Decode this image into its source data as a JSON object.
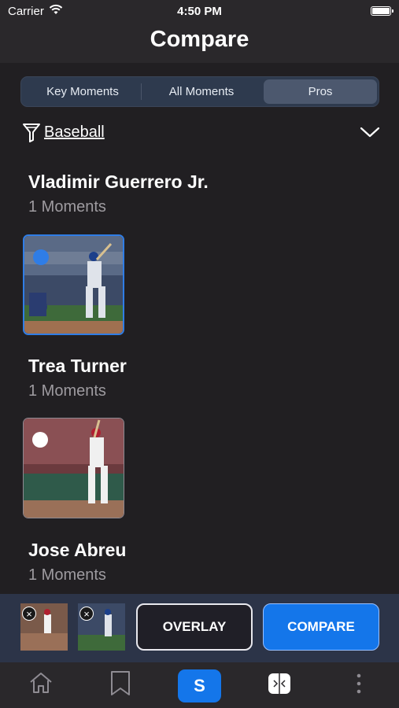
{
  "status": {
    "carrier": "Carrier",
    "time": "4:50 PM"
  },
  "header": {
    "title": "Compare"
  },
  "tabs": [
    {
      "label": "Key Moments",
      "selected": false
    },
    {
      "label": "All Moments",
      "selected": false
    },
    {
      "label": "Pros",
      "selected": true
    }
  ],
  "filter": {
    "label": "Baseball"
  },
  "players": [
    {
      "name": "Vladimir Guerrero Jr.",
      "moments": "1 Moments",
      "selected": true
    },
    {
      "name": "Trea Turner",
      "moments": "1 Moments",
      "selected": false
    },
    {
      "name": "Jose Abreu",
      "moments": "1 Moments",
      "selected": false
    }
  ],
  "tray": {
    "overlay_label": "OVERLAY",
    "compare_label": "COMPARE",
    "remove_symbol": "×"
  },
  "tabbar": {
    "center_letter": "S",
    "items": [
      "home-icon",
      "bookmark-icon",
      "swing-app-icon",
      "compare-icon",
      "more-icon"
    ]
  },
  "colors": {
    "accent": "#1476ea",
    "selection": "#2f7de6",
    "background": "#211f22"
  }
}
